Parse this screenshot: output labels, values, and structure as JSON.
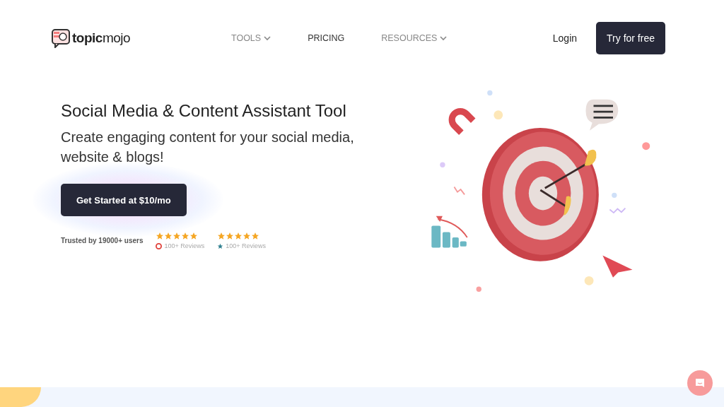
{
  "header": {
    "logo": {
      "text_bold": "topic",
      "text_light": "mojo"
    },
    "nav": [
      {
        "label": "TOOLS",
        "has_menu": true
      },
      {
        "label": "PRICING",
        "has_menu": false
      },
      {
        "label": "RESOURCES",
        "has_menu": true
      }
    ],
    "login": "Login",
    "cta": "Try for free"
  },
  "hero": {
    "title": "Social Media & Content Assistant Tool",
    "subtitle": "Create engaging content for your social media, website & blogs!",
    "button": "Get Started at $10/mo",
    "trusted": "Trusted by 19000+ users",
    "ratings": [
      {
        "kind": "g2",
        "stars": 5,
        "reviews": "100+ Reviews"
      },
      {
        "kind": "star",
        "stars": 5,
        "reviews": "100+ Reviews"
      }
    ]
  }
}
